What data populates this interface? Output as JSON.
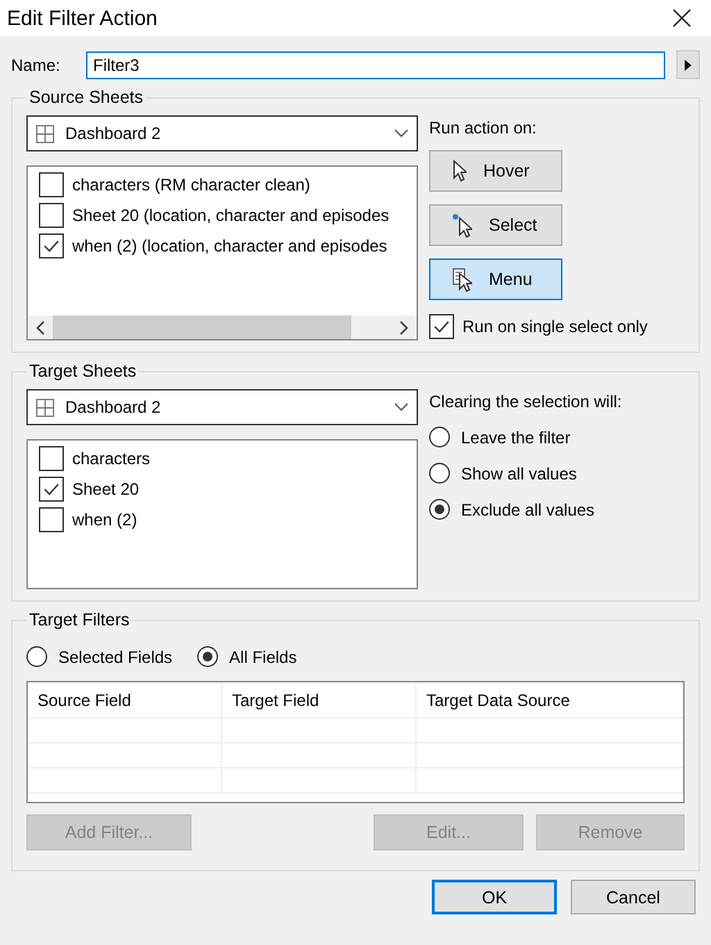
{
  "window": {
    "title": "Edit Filter Action"
  },
  "name": {
    "label": "Name:",
    "value": "Filter3",
    "focused": true
  },
  "source_sheets": {
    "title": "Source Sheets",
    "dropdown": {
      "value": "Dashboard 2"
    },
    "items": [
      {
        "label": "characters (RM character clean)",
        "checked": false
      },
      {
        "label": "Sheet 20 (location, character and episodes",
        "checked": false
      },
      {
        "label": "when (2) (location, character and episodes",
        "checked": true
      }
    ],
    "run_action_label": "Run action on:",
    "run_actions": [
      {
        "kind": "hover",
        "label": "Hover",
        "selected": false
      },
      {
        "kind": "select",
        "label": "Select",
        "selected": false
      },
      {
        "kind": "menu",
        "label": "Menu",
        "selected": true
      }
    ],
    "single_select": {
      "label": "Run on single select only",
      "checked": true
    }
  },
  "target_sheets": {
    "title": "Target Sheets",
    "dropdown": {
      "value": "Dashboard 2"
    },
    "items": [
      {
        "label": "characters",
        "checked": false
      },
      {
        "label": "Sheet 20",
        "checked": true
      },
      {
        "label": "when (2)",
        "checked": false
      }
    ],
    "clearing_label": "Clearing the selection will:",
    "clearing_options": [
      {
        "label": "Leave the filter",
        "selected": false
      },
      {
        "label": "Show all values",
        "selected": false
      },
      {
        "label": "Exclude all values",
        "selected": true
      }
    ]
  },
  "target_filters": {
    "title": "Target Filters",
    "scope_options": [
      {
        "label": "Selected Fields",
        "selected": false
      },
      {
        "label": "All Fields",
        "selected": true
      }
    ],
    "columns": [
      "Source Field",
      "Target Field",
      "Target Data Source"
    ],
    "buttons": [
      {
        "label": "Add Filter...",
        "disabled": true
      },
      {
        "label": "Edit...",
        "disabled": true
      },
      {
        "label": "Remove",
        "disabled": true
      }
    ]
  },
  "dialog_buttons": [
    {
      "label": "OK",
      "default": true
    },
    {
      "label": "Cancel",
      "default": false
    }
  ]
}
